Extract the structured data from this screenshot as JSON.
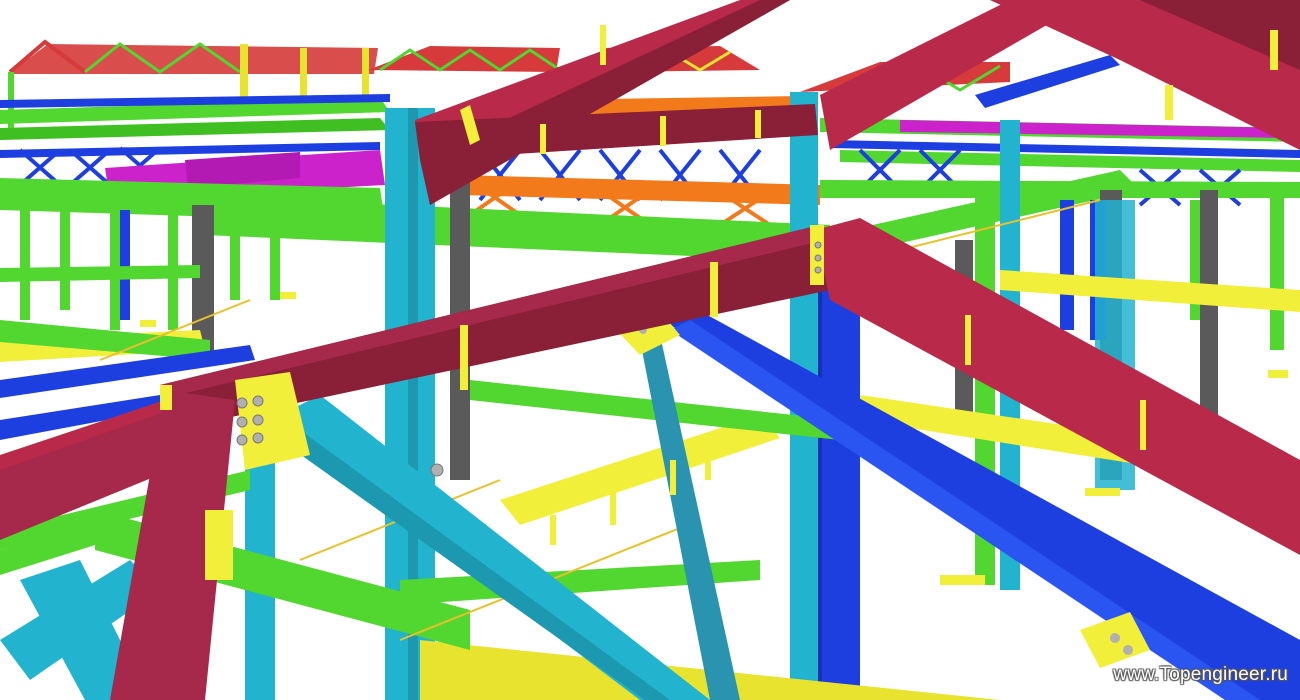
{
  "watermark": "www.Topengineer.ru",
  "colors": {
    "rafter": "#b8294a",
    "rafter_dark": "#8a1f38",
    "beam_green": "#52d630",
    "column_cyan": "#22b3cf",
    "column_blue": "#1d3fe0",
    "brace_teal": "#2a93b0",
    "plate_yellow": "#f2ef3a",
    "truss_yellow": "#e8e32e",
    "grey_column": "#5a5a5a",
    "magenta": "#cc22cc",
    "orange": "#f27a1a",
    "bolt": "#b0b0b0"
  }
}
